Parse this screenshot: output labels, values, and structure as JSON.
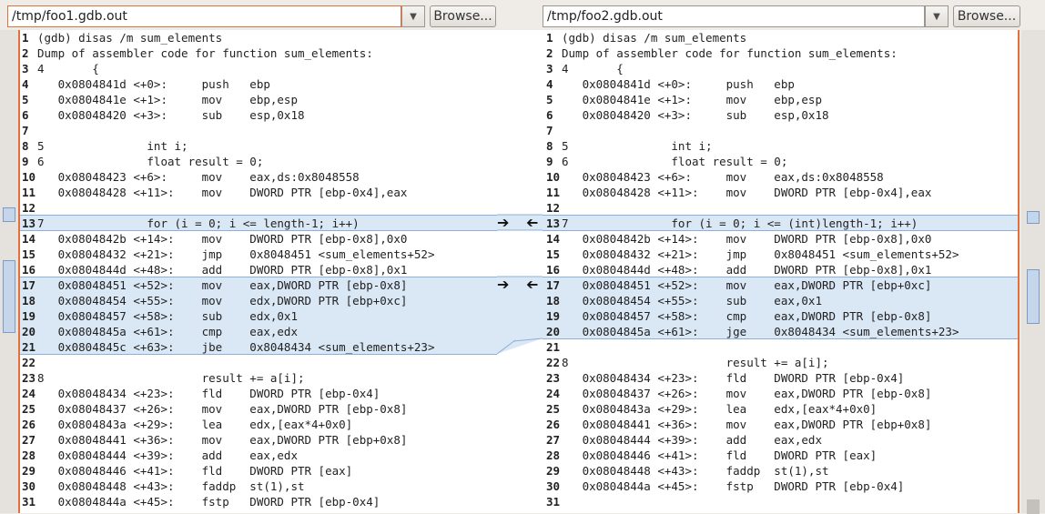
{
  "left": {
    "path": "/tmp/foo1.gdb.out",
    "browse_label": "Browse...",
    "lines": [
      {
        "n": "1",
        "t": "(gdb) disas /m sum_elements"
      },
      {
        "n": "2",
        "t": "Dump of assembler code for function sum_elements:"
      },
      {
        "n": "3",
        "t": "4       {"
      },
      {
        "n": "4",
        "t": "   0x0804841d <+0>:     push   ebp"
      },
      {
        "n": "5",
        "t": "   0x0804841e <+1>:     mov    ebp,esp"
      },
      {
        "n": "6",
        "t": "   0x08048420 <+3>:     sub    esp,0x18"
      },
      {
        "n": "7",
        "t": ""
      },
      {
        "n": "8",
        "t": "5               int i;"
      },
      {
        "n": "9",
        "t": "6               float result = 0;"
      },
      {
        "n": "10",
        "t": "   0x08048423 <+6>:     mov    eax,ds:0x8048558"
      },
      {
        "n": "11",
        "t": "   0x08048428 <+11>:    mov    DWORD PTR [ebp-0x4],eax"
      },
      {
        "n": "12",
        "t": ""
      },
      {
        "n": "13",
        "t": "7               for (i = 0; i <= length-1; i++)"
      },
      {
        "n": "14",
        "t": "   0x0804842b <+14>:    mov    DWORD PTR [ebp-0x8],0x0"
      },
      {
        "n": "15",
        "t": "   0x08048432 <+21>:    jmp    0x8048451 <sum_elements+52>"
      },
      {
        "n": "16",
        "t": "   0x0804844d <+48>:    add    DWORD PTR [ebp-0x8],0x1"
      },
      {
        "n": "17",
        "t": "   0x08048451 <+52>:    mov    eax,DWORD PTR [ebp-0x8]"
      },
      {
        "n": "18",
        "t": "   0x08048454 <+55>:    mov    edx,DWORD PTR [ebp+0xc]"
      },
      {
        "n": "19",
        "t": "   0x08048457 <+58>:    sub    edx,0x1"
      },
      {
        "n": "20",
        "t": "   0x0804845a <+61>:    cmp    eax,edx"
      },
      {
        "n": "21",
        "t": "   0x0804845c <+63>:    jbe    0x8048434 <sum_elements+23>"
      },
      {
        "n": "22",
        "t": ""
      },
      {
        "n": "23",
        "t": "8                       result += a[i];"
      },
      {
        "n": "24",
        "t": "   0x08048434 <+23>:    fld    DWORD PTR [ebp-0x4]"
      },
      {
        "n": "25",
        "t": "   0x08048437 <+26>:    mov    eax,DWORD PTR [ebp-0x8]"
      },
      {
        "n": "26",
        "t": "   0x0804843a <+29>:    lea    edx,[eax*4+0x0]"
      },
      {
        "n": "27",
        "t": "   0x08048441 <+36>:    mov    eax,DWORD PTR [ebp+0x8]"
      },
      {
        "n": "28",
        "t": "   0x08048444 <+39>:    add    eax,edx"
      },
      {
        "n": "29",
        "t": "   0x08048446 <+41>:    fld    DWORD PTR [eax]"
      },
      {
        "n": "30",
        "t": "   0x08048448 <+43>:    faddp  st(1),st"
      },
      {
        "n": "31",
        "t": "   0x0804844a <+45>:    fstp   DWORD PTR [ebp-0x4]"
      }
    ]
  },
  "right": {
    "path": "/tmp/foo2.gdb.out",
    "browse_label": "Browse...",
    "lines": [
      {
        "n": "1",
        "t": "(gdb) disas /m sum_elements"
      },
      {
        "n": "2",
        "t": "Dump of assembler code for function sum_elements:"
      },
      {
        "n": "3",
        "t": "4       {"
      },
      {
        "n": "4",
        "t": "   0x0804841d <+0>:     push   ebp"
      },
      {
        "n": "5",
        "t": "   0x0804841e <+1>:     mov    ebp,esp"
      },
      {
        "n": "6",
        "t": "   0x08048420 <+3>:     sub    esp,0x18"
      },
      {
        "n": "7",
        "t": ""
      },
      {
        "n": "8",
        "t": "5               int i;"
      },
      {
        "n": "9",
        "t": "6               float result = 0;"
      },
      {
        "n": "10",
        "t": "   0x08048423 <+6>:     mov    eax,ds:0x8048558"
      },
      {
        "n": "11",
        "t": "   0x08048428 <+11>:    mov    DWORD PTR [ebp-0x4],eax"
      },
      {
        "n": "12",
        "t": ""
      },
      {
        "n": "13",
        "t": "7               for (i = 0; i <= (int)length-1; i++)"
      },
      {
        "n": "14",
        "t": "   0x0804842b <+14>:    mov    DWORD PTR [ebp-0x8],0x0"
      },
      {
        "n": "15",
        "t": "   0x08048432 <+21>:    jmp    0x8048451 <sum_elements+52>"
      },
      {
        "n": "16",
        "t": "   0x0804844d <+48>:    add    DWORD PTR [ebp-0x8],0x1"
      },
      {
        "n": "17",
        "t": "   0x08048451 <+52>:    mov    eax,DWORD PTR [ebp+0xc]"
      },
      {
        "n": "18",
        "t": "   0x08048454 <+55>:    sub    eax,0x1"
      },
      {
        "n": "19",
        "t": "   0x08048457 <+58>:    cmp    eax,DWORD PTR [ebp-0x8]"
      },
      {
        "n": "20",
        "t": "   0x0804845a <+61>:    jge    0x8048434 <sum_elements+23>"
      },
      {
        "n": "21",
        "t": ""
      },
      {
        "n": "22",
        "t": "8                       result += a[i];"
      },
      {
        "n": "23",
        "t": "   0x08048434 <+23>:    fld    DWORD PTR [ebp-0x4]"
      },
      {
        "n": "24",
        "t": "   0x08048437 <+26>:    mov    eax,DWORD PTR [ebp-0x8]"
      },
      {
        "n": "25",
        "t": "   0x0804843a <+29>:    lea    edx,[eax*4+0x0]"
      },
      {
        "n": "26",
        "t": "   0x08048441 <+36>:    mov    eax,DWORD PTR [ebp+0x8]"
      },
      {
        "n": "27",
        "t": "   0x08048444 <+39>:    add    eax,edx"
      },
      {
        "n": "28",
        "t": "   0x08048446 <+41>:    fld    DWORD PTR [eax]"
      },
      {
        "n": "29",
        "t": "   0x08048448 <+43>:    faddp  st(1),st"
      },
      {
        "n": "30",
        "t": "   0x0804844a <+45>:    fstp   DWORD PTR [ebp-0x4]"
      },
      {
        "n": "31",
        "t": ""
      }
    ]
  },
  "icons": {
    "dropdown": "chevron-down-icon",
    "push_right": "arrow-right-icon",
    "push_left": "arrow-left-icon"
  }
}
